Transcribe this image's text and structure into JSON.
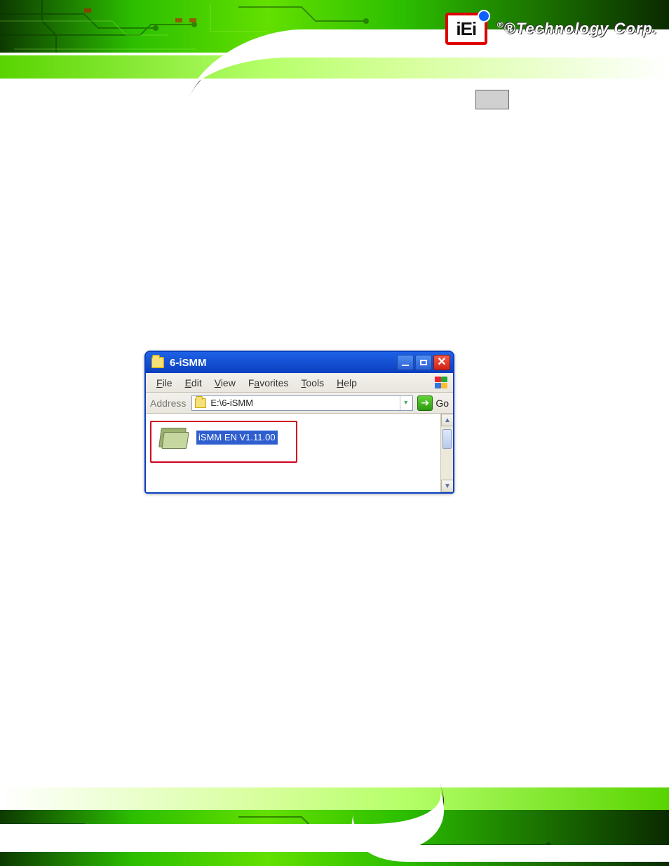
{
  "brand": {
    "logo_text": "iEi",
    "company": "®Technology Corp."
  },
  "explorer": {
    "title": "6-iSMM",
    "menus": {
      "file": {
        "label": "File",
        "accel_index": 0
      },
      "edit": {
        "label": "Edit",
        "accel_index": 0
      },
      "view": {
        "label": "View",
        "accel_index": 0
      },
      "favorites": {
        "label": "Favorites",
        "accel_index": 1
      },
      "tools": {
        "label": "Tools",
        "accel_index": 0
      },
      "help": {
        "label": "Help",
        "accel_index": 0
      }
    },
    "address": {
      "label": "Address",
      "path": "E:\\6-iSMM",
      "go_label": "Go"
    },
    "selected_item": {
      "name": "iSMM EN V1.11.00"
    }
  }
}
